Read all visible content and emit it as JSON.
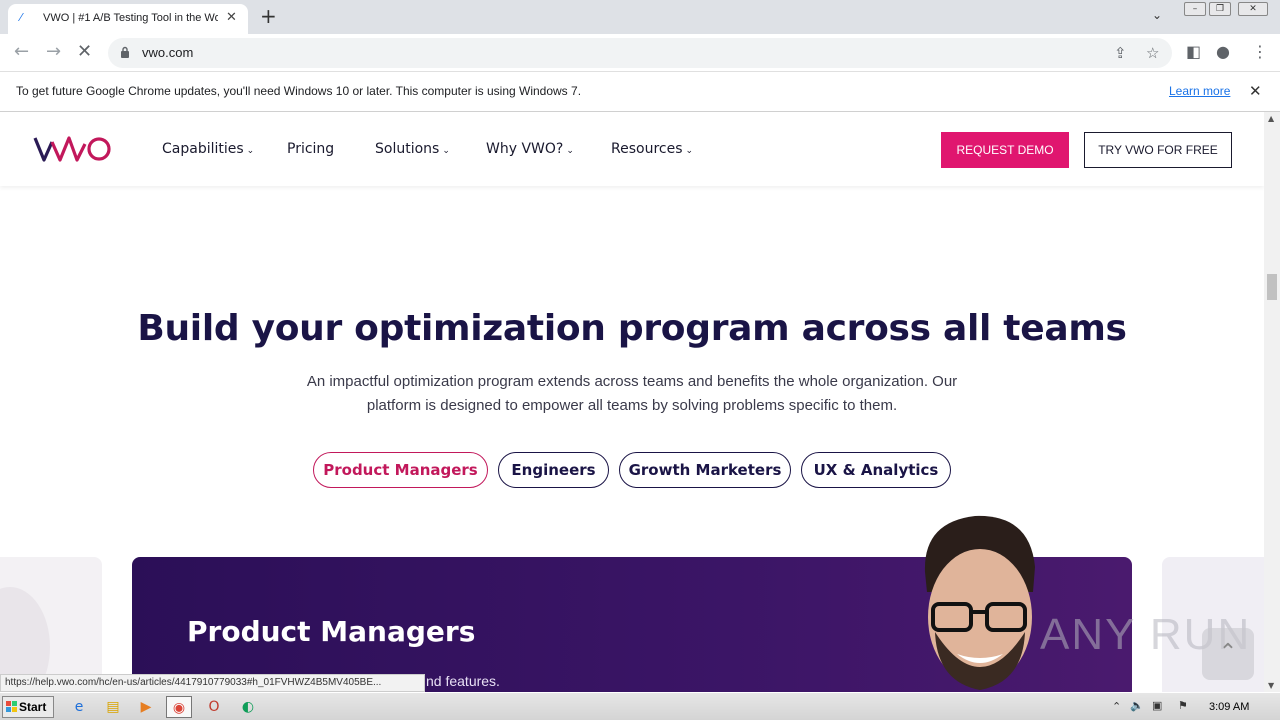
{
  "browser": {
    "tab_title": "VWO | #1 A/B Testing Tool in the World",
    "tab_close": "✕",
    "new_tab": "+",
    "url": "vwo.com",
    "info_message": "To get future Google Chrome updates, you'll need Windows 10 or later. This computer is using Windows 7.",
    "info_link": "Learn more",
    "status_url": "https://help.vwo.com/hc/en-us/articles/4417910779033#h_01FVHWZ4B5MV405BE..."
  },
  "site": {
    "nav": [
      {
        "label": "Capabilities",
        "dropdown": true
      },
      {
        "label": "Pricing",
        "dropdown": false
      },
      {
        "label": "Solutions",
        "dropdown": true
      },
      {
        "label": "Why VWO?",
        "dropdown": true
      },
      {
        "label": "Resources",
        "dropdown": true
      }
    ],
    "request_demo": "REQUEST DEMO",
    "try_free": "TRY VWO FOR FREE",
    "hero_title": "Build your optimization program across all teams",
    "hero_subtitle": "An impactful optimization program extends across teams and benefits the whole organization. Our platform is designed to empower all teams by solving problems specific to them.",
    "teams": [
      {
        "label": "Product Managers",
        "active": true
      },
      {
        "label": "Engineers",
        "active": false
      },
      {
        "label": "Growth Marketers",
        "active": false
      },
      {
        "label": "UX & Analytics",
        "active": false
      }
    ],
    "card_title": "Product Managers",
    "card_desc_visible": "nd features."
  },
  "watermark": "ANY RUN",
  "taskbar": {
    "start": "Start",
    "clock": "3:09 AM"
  },
  "colors": {
    "brand_pink": "#e0166f",
    "navy": "#1a1446",
    "card_purple": "#2b0f57"
  }
}
